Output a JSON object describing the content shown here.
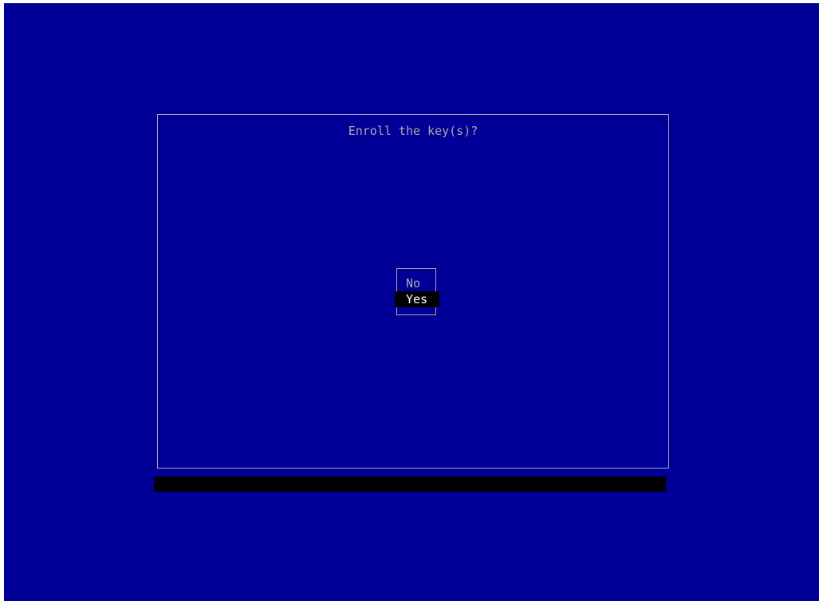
{
  "dialog": {
    "title": "Enroll the key(s)?"
  },
  "menu": {
    "items": [
      {
        "label": "No",
        "selected": false
      },
      {
        "label": "Yes",
        "selected": true
      }
    ]
  },
  "colors": {
    "background": "#000099",
    "border": "#a8a8a8",
    "text": "#a8a8a8",
    "highlight_bg": "#000000",
    "highlight_text": "#ffffff",
    "status_bar": "#000000"
  }
}
